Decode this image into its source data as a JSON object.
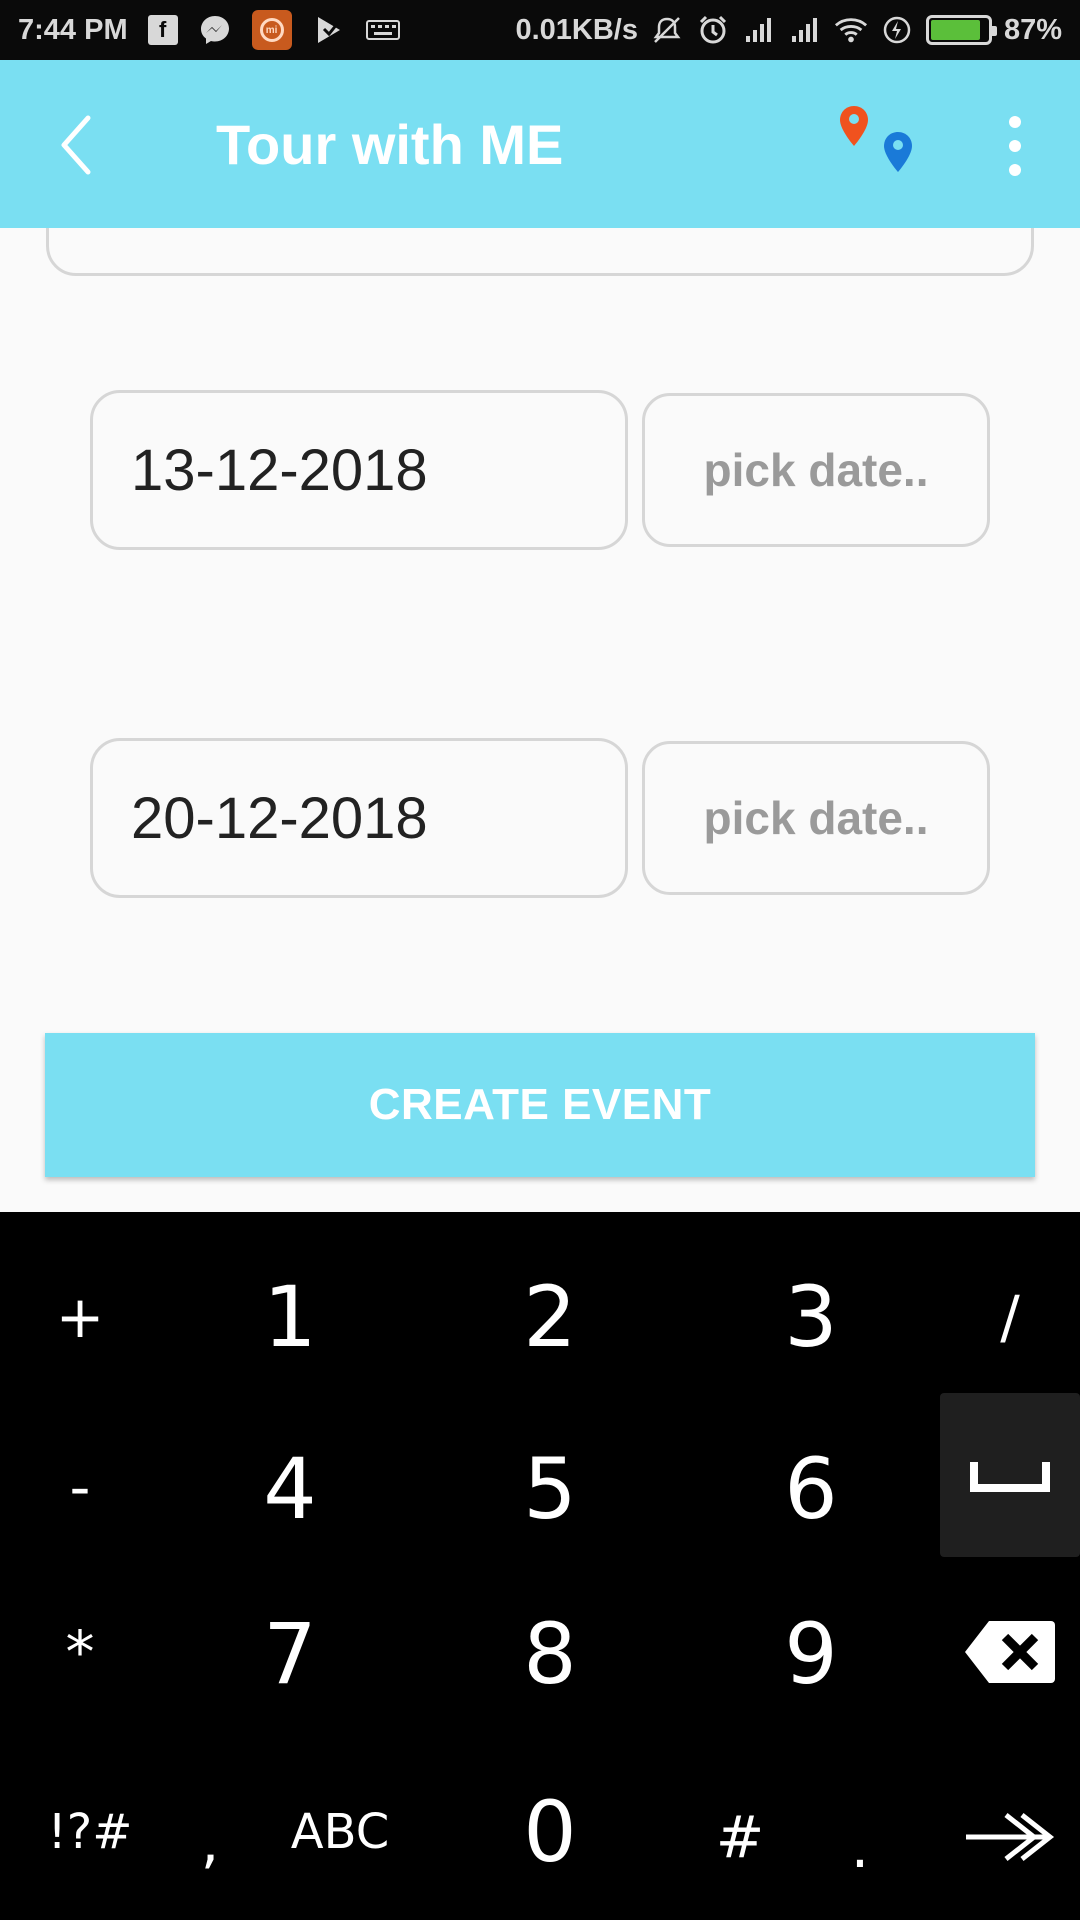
{
  "status_bar": {
    "time": "7:44 PM",
    "net_speed": "0.01KB/s",
    "battery_pct": "87%",
    "battery_level": 0.87,
    "icons": [
      "facebook-icon",
      "messenger-icon",
      "mi-icon",
      "play-icon",
      "keyboard-icon",
      "mute-icon",
      "alarm-icon",
      "signal-icon",
      "signal-icon",
      "wifi-icon",
      "charging-icon",
      "battery-icon"
    ]
  },
  "appbar": {
    "title": "Tour with ME",
    "back_icon": "back-arrow-icon",
    "map_icon": "map-pins-icon",
    "menu_icon": "more-vert-icon",
    "color": "#7adff2"
  },
  "form": {
    "start_date": "13-12-2018",
    "end_date": "20-12-2018",
    "pick_start_label": "pick date..",
    "pick_end_label": "pick date..",
    "create_label": "CREATE EVENT"
  },
  "keyboard": {
    "rows": [
      [
        "+",
        "1",
        "2",
        "3",
        "/"
      ],
      [
        "-",
        "4",
        "5",
        "6",
        "␣"
      ],
      [
        "*",
        "7",
        "8",
        "9",
        "⌫"
      ],
      [
        "!?#",
        ",",
        "ABC",
        "0",
        "#",
        ".",
        "→"
      ]
    ]
  }
}
